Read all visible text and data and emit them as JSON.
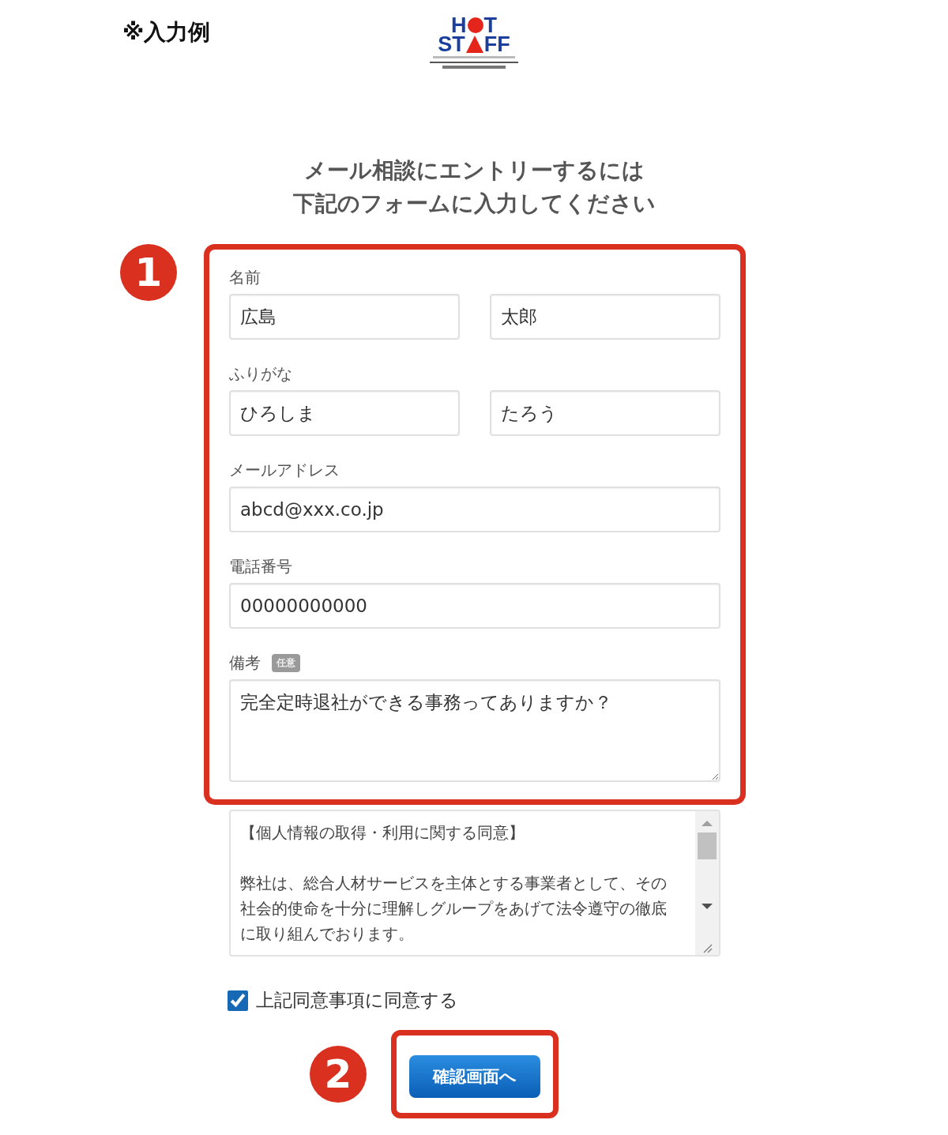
{
  "example_label": "※入力例",
  "logo": {
    "line1": [
      "H",
      "T"
    ],
    "line2": [
      "ST",
      "FF"
    ]
  },
  "heading": [
    "メール相談にエントリーするには",
    "下記のフォームに入力してください"
  ],
  "steps": [
    "1",
    "2"
  ],
  "fields": [
    {
      "kind": "pair",
      "label": "名前",
      "values": [
        "広島",
        "太郎"
      ]
    },
    {
      "kind": "pair",
      "label": "ふりがな",
      "values": [
        "ひろしま",
        "たろう"
      ]
    },
    {
      "kind": "single",
      "label": "メールアドレス",
      "values": [
        "abcd@xxx.co.jp"
      ]
    },
    {
      "kind": "single",
      "label": "電話番号",
      "values": [
        "00000000000"
      ]
    },
    {
      "kind": "textarea",
      "label": "備考",
      "badge": "任意",
      "values": [
        "完全定時退社ができる事務ってありますか？"
      ]
    }
  ],
  "consent": {
    "title": "【個人情報の取得・利用に関する同意】",
    "paragraph": "弊社は、総合人材サービスを主体とする事業者として、その社会的使命を十分に理解しグループをあげて法令遵守の徹底に取り組んでおります。"
  },
  "agree": {
    "label": "上記同意事項に同意する",
    "checked": true
  },
  "submit": {
    "label": "確認画面へ"
  }
}
